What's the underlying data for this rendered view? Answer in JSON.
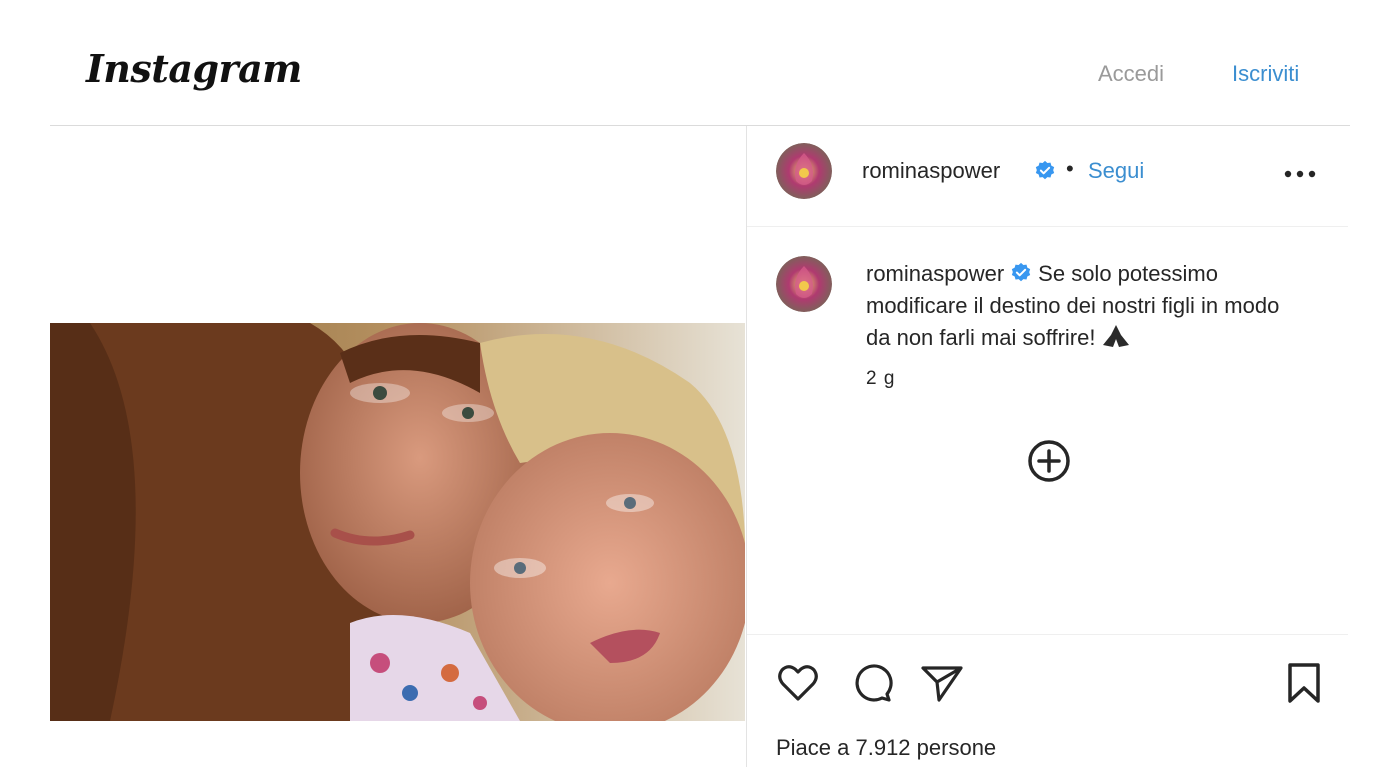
{
  "header": {
    "logo_text": "Instagram",
    "login_label": "Accedi",
    "signup_label": "Iscriviti"
  },
  "post": {
    "username": "rominaspower",
    "follow_label": "Segui",
    "separator": "•",
    "caption_text": "Se solo potessimo modificare il destino dei nostri figli in modo da non farli mai soffrire!",
    "age": "2 g",
    "likes_text": "Piace a 7.912 persone"
  },
  "icons": {
    "verified": "verified-badge-icon",
    "more": "more-options-icon",
    "pray": "praying-hands-emoji-icon",
    "plus": "plus-circle-icon",
    "like": "heart-icon",
    "comment": "comment-icon",
    "share": "share-icon",
    "save": "bookmark-icon"
  },
  "colors": {
    "accent": "#3b8ed0",
    "muted": "#9a9a9a",
    "text": "#262626"
  }
}
